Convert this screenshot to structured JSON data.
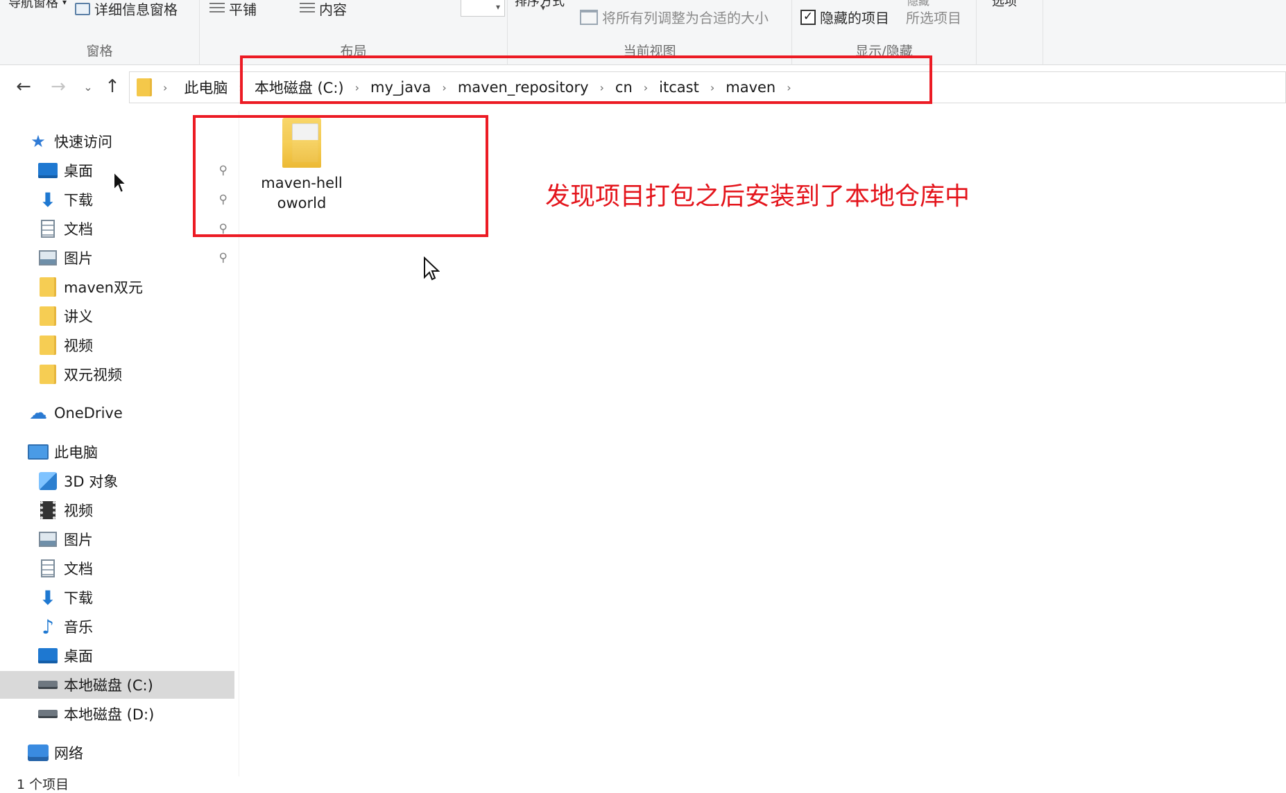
{
  "ribbon": {
    "pane_group": {
      "title": "窗格",
      "details_pane": "详细信息窗格",
      "nav_pane": "导航窗格"
    },
    "layout_group": {
      "title": "布局",
      "tiles": "平铺",
      "content": "内容"
    },
    "view_group": {
      "title": "当前视图",
      "sort_by": "排序方式",
      "fit_columns": "将所有列调整为合适的大小"
    },
    "showhide_group": {
      "title": "显示/隐藏",
      "hidden_items": "隐藏的项目",
      "hidden_checked": "✓",
      "hide_selected": "所选项目",
      "hide_label": "隐藏",
      "options": "选项"
    }
  },
  "address": {
    "back": "←",
    "forward": "→",
    "recent": "⌄",
    "up": "↑",
    "crumbs": [
      "此电脑",
      "本地磁盘 (C:)",
      "my_java",
      "maven_repository",
      "cn",
      "itcast",
      "maven"
    ],
    "separator": "›"
  },
  "nav": {
    "quick_access": "快速访问",
    "quick_items": [
      "桌面",
      "下载",
      "文档",
      "图片",
      "maven双元",
      "讲义",
      "视频",
      "双元视频"
    ],
    "onedrive": "OneDrive",
    "this_pc": "此电脑",
    "pc_items": [
      "3D 对象",
      "视频",
      "图片",
      "文档",
      "下载",
      "音乐",
      "桌面",
      "本地磁盘 (C:)",
      "本地磁盘 (D:)"
    ],
    "network": "网络",
    "pin_glyph": "📌"
  },
  "content": {
    "items": [
      {
        "name": "maven-helloworld"
      }
    ]
  },
  "annotation": "发现项目打包之后安装到了本地仓库中",
  "status": {
    "count": "1 个项目"
  },
  "colors": {
    "highlight_red": "#ec1b24",
    "annotation_red": "#e4151c",
    "selected_nav": "#d9d9d9",
    "folder_yellow": "#f6cd53"
  }
}
